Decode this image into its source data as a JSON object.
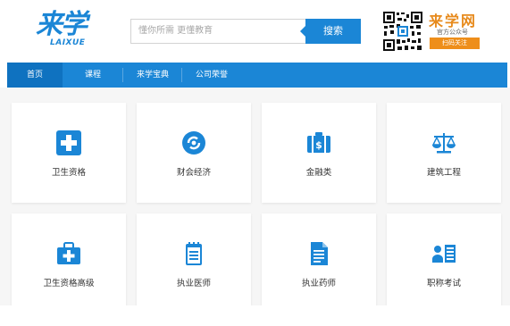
{
  "header": {
    "logo_text": "来学",
    "logo_sub": "LAIXUE",
    "search_placeholder": "懂你所需 更懂教育",
    "search_button": "搜索",
    "brand_title": "来学网",
    "brand_subtitle": "官方公众号",
    "brand_scan": "扫码关注"
  },
  "nav": {
    "items": [
      {
        "label": "首页"
      },
      {
        "label": "课程"
      },
      {
        "label": "来学宝典"
      },
      {
        "label": "公司荣誉"
      }
    ]
  },
  "categories": [
    {
      "label": "卫生资格",
      "icon": "medical-cross-icon"
    },
    {
      "label": "财会经济",
      "icon": "money-cycle-icon"
    },
    {
      "label": "金融类",
      "icon": "money-bag-icon"
    },
    {
      "label": "建筑工程",
      "icon": "scales-icon"
    },
    {
      "label": "卫生资格高级",
      "icon": "medical-kit-icon"
    },
    {
      "label": "执业医师",
      "icon": "notepad-icon"
    },
    {
      "label": "执业药师",
      "icon": "document-icon"
    },
    {
      "label": "职称考试",
      "icon": "id-card-icon"
    }
  ],
  "colors": {
    "brand_blue": "#1b86d6",
    "brand_orange": "#e78a1c"
  }
}
